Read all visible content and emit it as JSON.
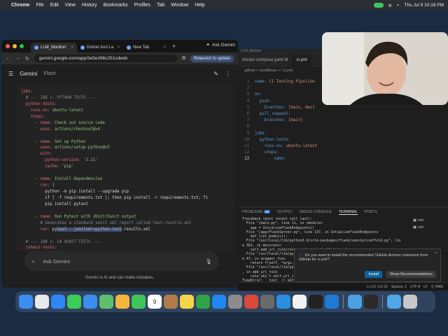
{
  "menubar": {
    "app": "Chrome",
    "items": [
      "File",
      "Edit",
      "View",
      "History",
      "Bookmarks",
      "Profiles",
      "Tab",
      "Window",
      "Help"
    ],
    "clock": "Thu Jul 9  10:18 PM"
  },
  "browser": {
    "tabs": [
      {
        "label": "LLM_Monitor/",
        "active": true
      },
      {
        "label": "Dotnet And La",
        "active": false
      },
      {
        "label": "New Tab",
        "active": false
      }
    ],
    "new_tab": "+",
    "ask_gemini": "Ask Gemini",
    "url": "gemini.google.com/app/3e5e396c251cdeeb",
    "relaunch": "Relaunch to update",
    "gemini": {
      "title": "Gemini",
      "model": "Flash",
      "code": [
        [
          [
            "k",
            "jobs:"
          ]
        ],
        [
          [
            "c",
            "  # --- JOB 1: PYTHON TESTS ---"
          ]
        ],
        [
          [
            "k",
            "  python-tests:"
          ]
        ],
        [
          [
            "k",
            "    runs-on: "
          ],
          [
            "s",
            "ubuntu-latest"
          ]
        ],
        [
          [
            "k",
            "    steps:"
          ]
        ],
        [
          [
            "v",
            "      - "
          ],
          [
            "k",
            "name: "
          ],
          [
            "s",
            "Check out source code"
          ]
        ],
        [
          [
            "k",
            "        uses: "
          ],
          [
            "s",
            "actions/checkout@v4"
          ]
        ],
        [
          [
            "v",
            ""
          ]
        ],
        [
          [
            "v",
            "      - "
          ],
          [
            "k",
            "name: "
          ],
          [
            "s",
            "Set up Python"
          ]
        ],
        [
          [
            "k",
            "        uses: "
          ],
          [
            "s",
            "actions/setup-python@v5"
          ]
        ],
        [
          [
            "k",
            "        with:"
          ]
        ],
        [
          [
            "k",
            "          python-version: "
          ],
          [
            "s",
            "'3.11'"
          ]
        ],
        [
          [
            "k",
            "          cache: "
          ],
          [
            "s",
            "'pip'"
          ]
        ],
        [
          [
            "v",
            ""
          ]
        ],
        [
          [
            "v",
            "      - "
          ],
          [
            "k",
            "name: "
          ],
          [
            "s",
            "Install Dependencies"
          ]
        ],
        [
          [
            "k",
            "        run: "
          ],
          [
            "v",
            "|"
          ]
        ],
        [
          [
            "v",
            "          python -m pip install --upgrade pip"
          ]
        ],
        [
          [
            "v",
            "          if [ -f requirements.txt ]; then pip install -r requirements.txt; fi"
          ]
        ],
        [
          [
            "v",
            "          pip install pytest"
          ]
        ],
        [
          [
            "v",
            ""
          ]
        ],
        [
          [
            "v",
            "      - "
          ],
          [
            "k",
            "name: "
          ],
          [
            "s",
            "Run Pytest with JUnit/Xunit output"
          ]
        ],
        [
          [
            "c",
            "        # Generates a standard xunit xml report called test-results.xml"
          ]
        ],
        [
          [
            "k",
            "        run: "
          ],
          [
            "v",
            "py"
          ],
          [
            "hl",
            "test --junitxml=python-test"
          ],
          [
            "v",
            "-results.xml"
          ]
        ],
        [
          [
            "v",
            ""
          ]
        ],
        [
          [
            "c",
            "  # --- JOB 2: C# XUNIT TESTS ---"
          ]
        ],
        [
          [
            "k",
            "  csharp-tests:"
          ]
        ]
      ],
      "ask_placeholder": "Ask Gemini",
      "disclaimer": "Gemini is AI and can make mistakes."
    }
  },
  "vscode": {
    "top_label": "LLM_Monitor",
    "tabs": [
      {
        "label": "docker-compose.yaml M",
        "active": false
      },
      {
        "label": "ci.yml",
        "active": true
      }
    ],
    "breadcrumb": ".github > workflows > ! ci.yml",
    "editor": [
      {
        "n": "1",
        "k": "name: ",
        "v": "CI Testing Pipeline"
      },
      {
        "n": "2",
        "k": "",
        "v": ""
      },
      {
        "n": "3",
        "k": "on:",
        "v": ""
      },
      {
        "n": "4",
        "k": "  push:",
        "v": ""
      },
      {
        "n": "5",
        "k": "    branches: ",
        "v": "[main, dev]"
      },
      {
        "n": "6",
        "k": "  pull_request:",
        "v": ""
      },
      {
        "n": "7",
        "k": "    branches: ",
        "v": "[main]"
      },
      {
        "n": "8",
        "k": "",
        "v": ""
      },
      {
        "n": "9",
        "k": "jobs:",
        "v": ""
      },
      {
        "n": "10",
        "k": "  python-tests:",
        "v": ""
      },
      {
        "n": "11",
        "k": "    runs-on: ",
        "v": "ubuntu-latest"
      },
      {
        "n": "12",
        "k": "    steps:",
        "v": ""
      },
      {
        "n": "13",
        "k": "      - name:",
        "v": ""
      }
    ],
    "panel_tabs": [
      {
        "label": "PROBLEMS",
        "badge": "10"
      },
      {
        "label": "OUTPUT"
      },
      {
        "label": "DEBUG CONSOLE"
      },
      {
        "label": "TERMINAL",
        "active": true
      },
      {
        "label": "PORTS"
      }
    ],
    "terminal": "Traceback (most recent call last):\n  File \"/main.py\", line 11, in <module>\n    app = IntializeFlaskEndpoints()\n  File \"/app/FlaskServer.py\", line 137, in IntializeFlaskEndpoints\n    def list_models():\n  File \"/usr/local/lib/python3.9/site-packages/flask/sansio/scaffold.py\", lin\ne 362, in decorator\n    self.add_url_rule(rule, endpoint, f, **options)\n  File \"/usr/local/lib/python3.\ne 47, in wrapper_func\n    return f(self, *args, **kwa\n  File \"/usr/local/lib/python3.\n, in add_url_rule\n    rule_obj = self.url_rule_cl\nTypeError: __init__() got an u\n(.venv) crispybacon@Crispys-MacBook-Pro LLM_Monitor %",
    "shells": [
      "zsh",
      "zsh"
    ],
    "notification": {
      "text": "Do you want to install the recommended 'GitHub Actions' extension from GitHub for ci.yml?",
      "install": "Install",
      "show": "Show Recommendations"
    },
    "status": [
      "Ln 13, Col 15",
      "Spaces: 2",
      "UTF-8",
      "LF",
      "{} YAML"
    ]
  },
  "colors": {
    "accent": "#3a7bd5",
    "install": "#0e639c",
    "gemini_bg": "#1f1f1f"
  },
  "dock": [
    "finder-icon",
    "launchpad-icon",
    "safari-icon",
    "messages-icon",
    "mail-icon",
    "maps-icon",
    "photos-icon",
    "facetime-icon",
    "calendar-icon",
    "contacts-icon",
    "notes-icon",
    "numbers-icon",
    "app-store-icon",
    "settings-icon",
    "chatgpt-icon",
    "vpn-icon",
    "docker-icon",
    "chrome-icon",
    "terminal-icon",
    "vscode-icon",
    "mail-app-icon",
    "clock-icon",
    "folder-icon",
    "trash-icon"
  ],
  "calendar_day": "9"
}
